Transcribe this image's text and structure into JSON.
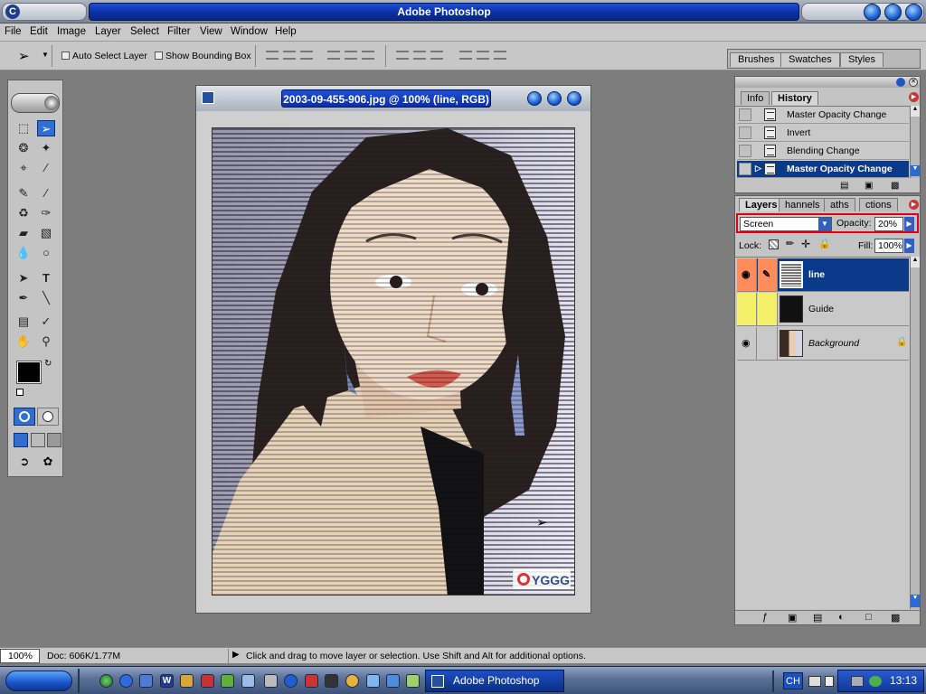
{
  "app": {
    "title": "Adobe Photoshop"
  },
  "menu": [
    "File",
    "Edit",
    "Image",
    "Layer",
    "Select",
    "Filter",
    "View",
    "Window",
    "Help"
  ],
  "options": {
    "auto_select_label": "Auto Select Layer",
    "show_bounding_label": "Show Bounding Box",
    "palette_tabs": [
      "Brushes",
      "Swatches",
      "Styles"
    ]
  },
  "document": {
    "title": "2003-09-455-906.jpg @ 100% (line, RGB)",
    "watermark": "YGGG"
  },
  "history_panel": {
    "tabs": [
      "Info",
      "History"
    ],
    "active_tab": "History",
    "items": [
      {
        "label": "Master Opacity Change",
        "selected": false
      },
      {
        "label": "Invert",
        "selected": false
      },
      {
        "label": "Blending Change",
        "selected": false
      },
      {
        "label": "Master Opacity Change",
        "selected": true
      }
    ]
  },
  "layers_panel": {
    "tabs": [
      "Layers",
      "Channels",
      "Paths",
      "Actions"
    ],
    "visible_tab_text": [
      "Layers",
      "hannels",
      "aths",
      "ctions"
    ],
    "blend_mode": "Screen",
    "opacity_label": "Opacity:",
    "opacity_value": "20%",
    "lock_label": "Lock:",
    "fill_label": "Fill:",
    "fill_value": "100%",
    "layers": [
      {
        "name": "line",
        "selected": true,
        "visible": true,
        "row_color": "#ff8c5a"
      },
      {
        "name": "Guide",
        "selected": false,
        "visible": false,
        "row_color": "#f5f06a"
      },
      {
        "name": "Background",
        "selected": false,
        "visible": true,
        "row_color": "#c9c9c9",
        "locked": true
      }
    ]
  },
  "statusbar": {
    "zoom": "100%",
    "doc_info": "Doc: 606K/1.77M",
    "hint": "Click and drag to move layer or selection.  Use Shift and Alt for additional options."
  },
  "taskbar": {
    "task_label": "Adobe Photoshop",
    "language": "CH",
    "clock": "13:13"
  },
  "colors": {
    "title_blue": "#0a2fa8",
    "selection_blue": "#0c3a8a",
    "highlight_red": "#e0001b"
  }
}
